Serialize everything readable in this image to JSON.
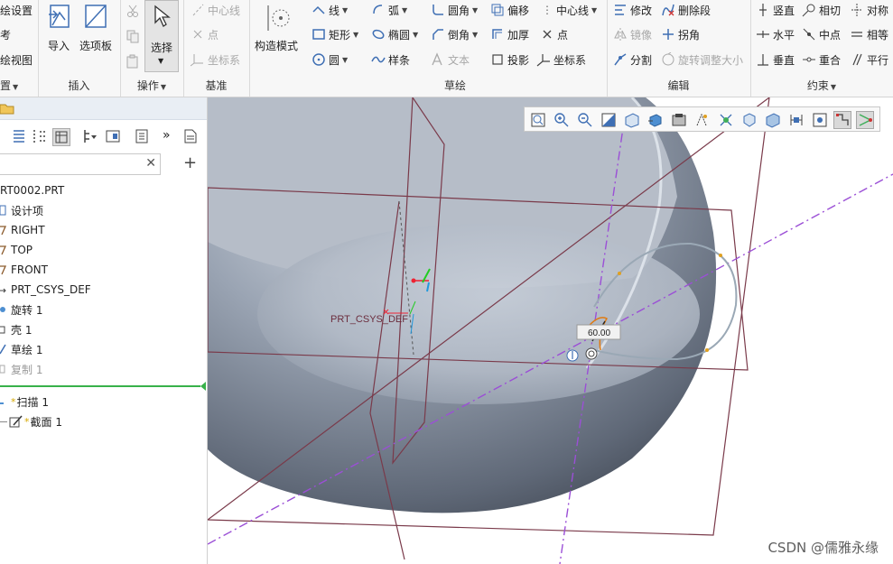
{
  "ribbon": {
    "settings_group": {
      "items": [
        "绘设置",
        "考",
        "绘视图"
      ],
      "label": "置"
    },
    "insert_group": {
      "label": "插入",
      "import_label": "导入",
      "palette_label": "选项板"
    },
    "operations_group": {
      "label": "操作",
      "select_label": "选择"
    },
    "datum_group": {
      "label": "基准",
      "centerline": "中心线",
      "point": "点",
      "csys": "坐标系"
    },
    "construction_mode": "构造模式",
    "sketch_group": {
      "label": "草绘",
      "line": "线",
      "arc": "弧",
      "fillet": "圆角",
      "offset": "偏移",
      "centerline": "中心线",
      "rectangle": "矩形",
      "ellipse": "椭圆",
      "chamfer": "倒角",
      "thicken": "加厚",
      "point": "点",
      "circle": "圆",
      "spline": "样条",
      "text": "文本",
      "project": "投影",
      "csys": "坐标系"
    },
    "edit_group": {
      "label": "编辑",
      "modify": "修改",
      "delete_segment": "删除段",
      "mirror": "镜像",
      "corner": "拐角",
      "divide": "分割",
      "rotate_resize": "旋转调整大小"
    },
    "constrain_group": {
      "label": "约束",
      "vertical": "竖直",
      "tangent": "相切",
      "symmetric": "对称",
      "horizontal": "水平",
      "midpoint": "中点",
      "equal": "相等",
      "perpendicular": "垂直",
      "coincident": "重合",
      "parallel": "平行"
    }
  },
  "model_tree": {
    "items": [
      {
        "label": "RT0002.PRT",
        "icon": "part-icon"
      },
      {
        "label": "设计项",
        "icon": "design-items-icon"
      },
      {
        "label": "RIGHT",
        "icon": "datum-plane-icon"
      },
      {
        "label": "TOP",
        "icon": "datum-plane-icon"
      },
      {
        "label": "FRONT",
        "icon": "datum-plane-icon"
      },
      {
        "label": "PRT_CSYS_DEF",
        "icon": "csys-icon"
      },
      {
        "label": "旋转 1",
        "icon": "revolve-icon"
      },
      {
        "label": "壳 1",
        "icon": "shell-icon"
      },
      {
        "label": "草绘 1",
        "icon": "sketch-icon"
      },
      {
        "label": "复制 1",
        "icon": "copy-icon"
      }
    ],
    "sweep": {
      "label": "扫描 1",
      "star": "*"
    },
    "section": {
      "label": "截面 1",
      "star": "*"
    },
    "search_placeholder": ""
  },
  "viewport": {
    "csys_label": "PRT_CSYS_DEF",
    "dimension_value": "60.00"
  },
  "watermark": "CSDN @儒雅永缘",
  "colors": {
    "accent_line": "#8b3a62",
    "centerline": "#9b4fd6",
    "sphere": "#8e99a9",
    "insert_indicator": "#38b14a"
  }
}
